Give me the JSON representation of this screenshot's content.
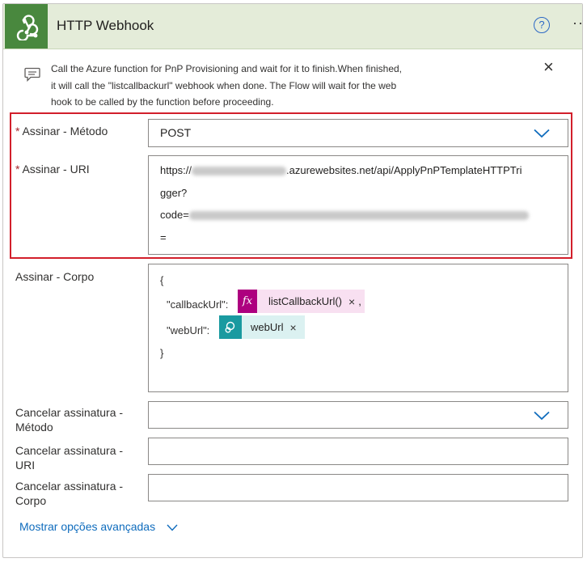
{
  "header": {
    "title": "HTTP Webhook",
    "help_icon": "question-circle-icon",
    "more_label": "··"
  },
  "comment": {
    "text": "Call the Azure function for PnP Provisioning and wait for it to finish.When finished, it will call the \"listcallbackurl\" webhook when done. The Flow will wait for the web hook to be called by the function before proceeding.",
    "lines": [
      "Call the Azure function for PnP Provisioning and wait for it to finish.When finished,",
      "it will call the \"listcallbackurl\" webhook when done. The Flow will wait for the web",
      "hook to be called by the function before proceeding."
    ],
    "close_label": "×"
  },
  "fields": {
    "subscribe_method": {
      "label": "Assinar - Método",
      "required": "*",
      "value": "POST"
    },
    "subscribe_uri": {
      "label": "Assinar - URI",
      "required": "*",
      "line1_prefix": "https://",
      "line1_suffix": ".azurewebsites.net/api/ApplyPnPTemplateHTTPTri",
      "line2": "gger?",
      "line3": "code=",
      "line4": "="
    },
    "subscribe_body": {
      "label": "Assinar - Corpo",
      "open_brace": "{",
      "callback_key": "\"callbackUrl\":",
      "callback_token": "listCallbackUrl()",
      "callback_comma": ",",
      "weburl_key": "\"webUrl\":",
      "weburl_token": "webUrl",
      "close_brace": "}",
      "remove_label": "×"
    },
    "unsubscribe_method": {
      "label_line1": "Cancelar assinatura -",
      "label_line2": "Método",
      "value": ""
    },
    "unsubscribe_uri": {
      "label_line1": "Cancelar assinatura -",
      "label_line2": "URI",
      "value": ""
    },
    "unsubscribe_body": {
      "label_line1": "Cancelar assinatura -",
      "label_line2": "Corpo",
      "value": ""
    }
  },
  "advanced": {
    "label": "Mostrar opções avançadas"
  },
  "colors": {
    "header_bg": "#e4ecd9",
    "app_icon_bg": "#49883e",
    "highlight_border": "#d21f2b",
    "link": "#0f6cbd",
    "expression_token": "#ad007f",
    "expression_token_bg": "#f8e0f1",
    "dynamic_token": "#1a9aa0",
    "dynamic_token_bg": "#dbf1f1"
  }
}
